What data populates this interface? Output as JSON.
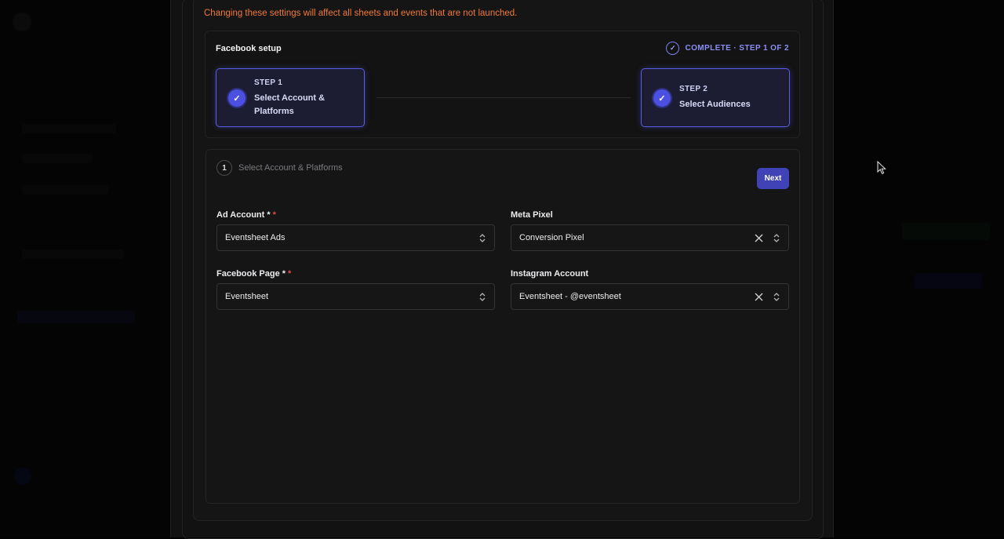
{
  "warning_text": "Changing these settings will affect all sheets and events that are not launched.",
  "setup": {
    "title": "Facebook setup",
    "status": "COMPLETE · STEP 1 OF 2",
    "steps": [
      {
        "number": "STEP 1",
        "label": "Select Account & Platforms",
        "complete": true
      },
      {
        "number": "STEP 2",
        "label": "Select Audiences",
        "complete": true
      }
    ]
  },
  "section": {
    "number": "1",
    "title": "Select Account & Platforms",
    "next_label": "Next"
  },
  "fields": {
    "ad_account": {
      "label": "Ad Account *",
      "required_mark": "*",
      "value": "Eventsheet Ads"
    },
    "meta_pixel": {
      "label": "Meta Pixel",
      "value": "Conversion Pixel"
    },
    "facebook_page": {
      "label": "Facebook Page *",
      "required_mark": "*",
      "value": "Eventsheet"
    },
    "instagram_account": {
      "label": "Instagram Account",
      "value": "Eventsheet - @eventsheet"
    }
  },
  "colors": {
    "accent": "#4b4fe2",
    "button": "#4043b6",
    "warning": "#f07a3a",
    "required": "#e5484d"
  }
}
